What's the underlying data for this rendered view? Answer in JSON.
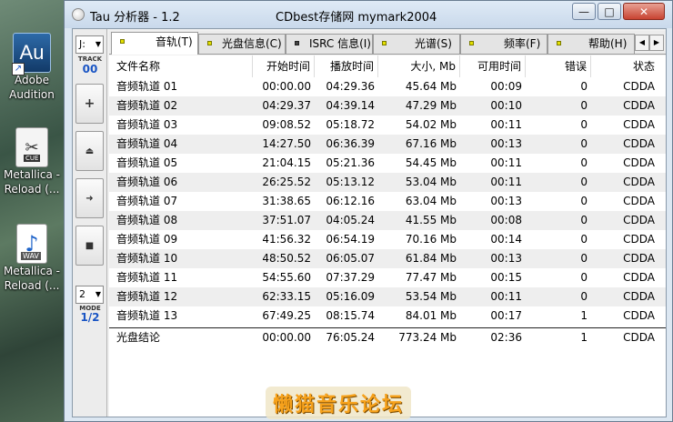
{
  "desktop": {
    "icons": [
      {
        "label": "Adobe Audition",
        "glyph": "Au",
        "icon": "adobe-audition-icon"
      },
      {
        "label": "Metallica - Reload (...",
        "glyph": "CUE",
        "icon": "cue-file-icon"
      },
      {
        "label": "Metallica - Reload (...",
        "glyph": "WAV",
        "icon": "wav-file-icon"
      }
    ]
  },
  "window": {
    "title": "Tau 分析器 - 1.2",
    "subtitle": "CDbest存储网 mymark2004",
    "buttons": {
      "minimize": "—",
      "maximize": "□",
      "close": "✕"
    }
  },
  "controls": {
    "drive": "J:",
    "track_label": "TRACK",
    "track_number": "00",
    "add_glyph": "+",
    "eject_glyph": "⏏",
    "play_glyph": "➜",
    "stop_glyph": "■",
    "mode_value": "2",
    "mode_label": "MODE",
    "mode_fraction": "1/2"
  },
  "tabs": [
    {
      "label": "音轨(T)",
      "led": "yellow",
      "active": true
    },
    {
      "label": "光盘信息(C)",
      "led": "yellow",
      "active": false
    },
    {
      "label": "ISRC 信息(I)",
      "led": "gray",
      "active": false
    },
    {
      "label": "光谱(S)",
      "led": "yellow",
      "active": false
    },
    {
      "label": "频率(F)",
      "led": "yellow",
      "active": false
    },
    {
      "label": "帮助(H)",
      "led": "yellow",
      "active": false
    }
  ],
  "table": {
    "headers": [
      "文件名称",
      "开始时间",
      "播放时间",
      "大小, Mb",
      "可用时间",
      "错误",
      "状态"
    ],
    "rows": [
      [
        "音频轨道 01",
        "00:00.00",
        "04:29.36",
        "45.64 Mb",
        "00:09",
        "0",
        "CDDA"
      ],
      [
        "音频轨道 02",
        "04:29.37",
        "04:39.14",
        "47.29 Mb",
        "00:10",
        "0",
        "CDDA"
      ],
      [
        "音频轨道 03",
        "09:08.52",
        "05:18.72",
        "54.02 Mb",
        "00:11",
        "0",
        "CDDA"
      ],
      [
        "音频轨道 04",
        "14:27.50",
        "06:36.39",
        "67.16 Mb",
        "00:13",
        "0",
        "CDDA"
      ],
      [
        "音频轨道 05",
        "21:04.15",
        "05:21.36",
        "54.45 Mb",
        "00:11",
        "0",
        "CDDA"
      ],
      [
        "音频轨道 06",
        "26:25.52",
        "05:13.12",
        "53.04 Mb",
        "00:11",
        "0",
        "CDDA"
      ],
      [
        "音频轨道 07",
        "31:38.65",
        "06:12.16",
        "63.04 Mb",
        "00:13",
        "0",
        "CDDA"
      ],
      [
        "音频轨道 08",
        "37:51.07",
        "04:05.24",
        "41.55 Mb",
        "00:08",
        "0",
        "CDDA"
      ],
      [
        "音频轨道 09",
        "41:56.32",
        "06:54.19",
        "70.16 Mb",
        "00:14",
        "0",
        "CDDA"
      ],
      [
        "音频轨道 10",
        "48:50.52",
        "06:05.07",
        "61.84 Mb",
        "00:13",
        "0",
        "CDDA"
      ],
      [
        "音频轨道 11",
        "54:55.60",
        "07:37.29",
        "77.47 Mb",
        "00:15",
        "0",
        "CDDA"
      ],
      [
        "音频轨道 12",
        "62:33.15",
        "05:16.09",
        "53.54 Mb",
        "00:11",
        "0",
        "CDDA"
      ],
      [
        "音频轨道 13",
        "67:49.25",
        "08:15.74",
        "84.01 Mb",
        "00:17",
        "1",
        "CDDA"
      ]
    ],
    "summary": [
      "光盘结论",
      "00:00.00",
      "76:05.24",
      "773.24 Mb",
      "02:36",
      "1",
      "CDDA"
    ]
  },
  "watermark": "懒猫音乐论坛"
}
